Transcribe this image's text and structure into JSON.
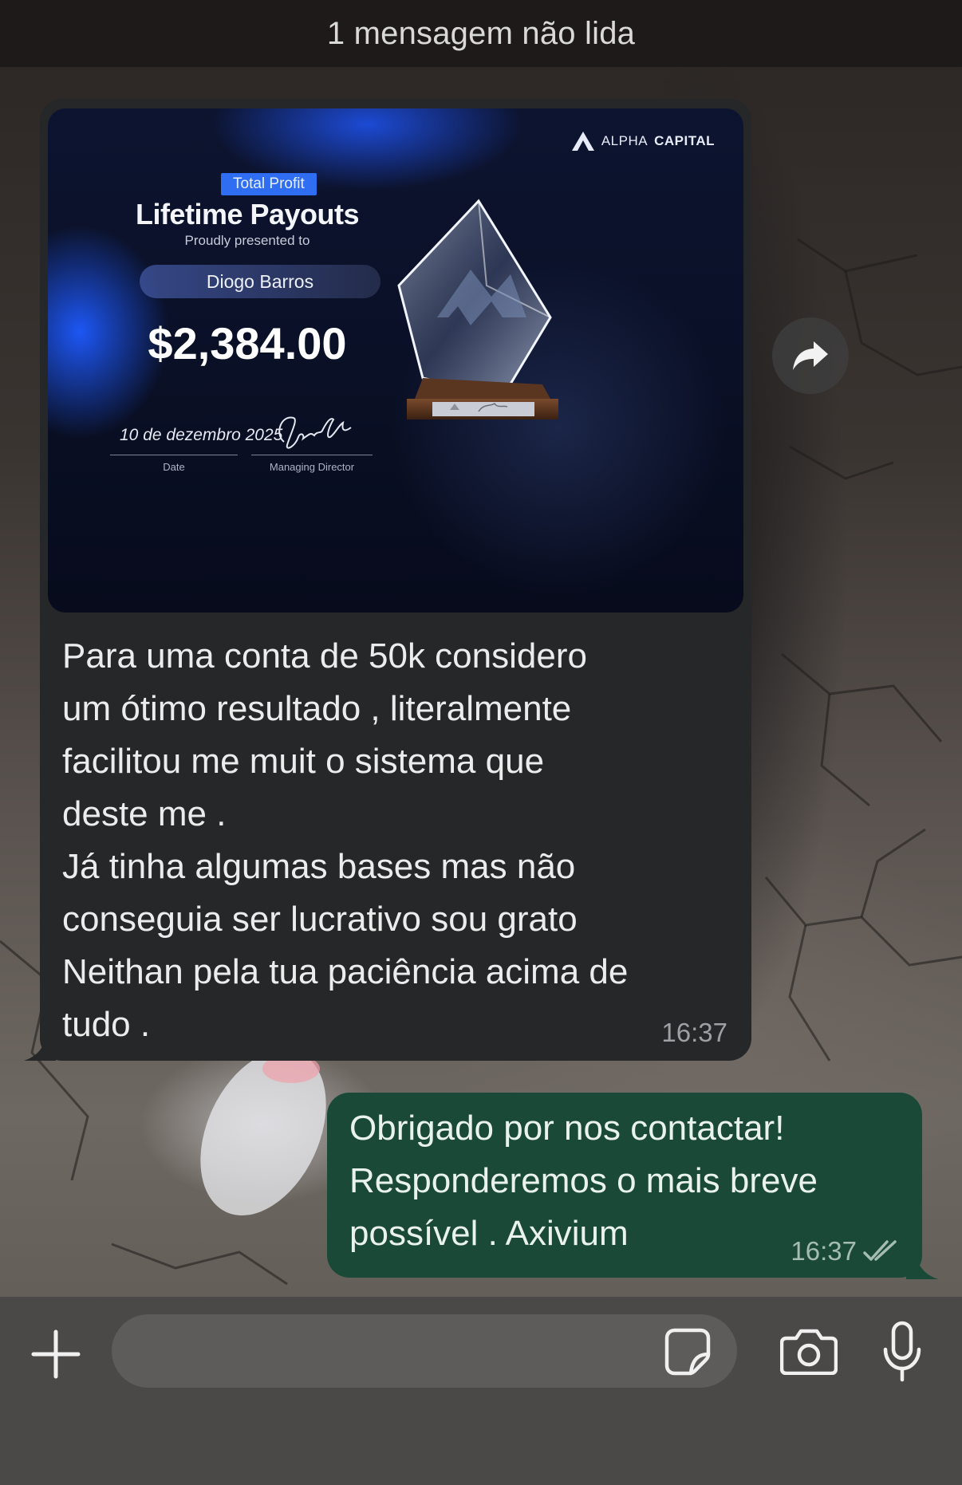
{
  "banner": {
    "unread_text": "1 mensagem não lida"
  },
  "incoming_message": {
    "image": {
      "brand_left": "ALPHA",
      "brand_right": "CAPITAL",
      "badge": "Total Profit",
      "title": "Lifetime Payouts",
      "presented_to": "Proudly presented to",
      "name": "Diogo Barros",
      "amount": "$2,384.00",
      "date": "10 de dezembro 2025",
      "date_label": "Date",
      "director_label": "Managing Director"
    },
    "text": "Para uma conta de 50k considero\num ótimo resultado , literalmente\nfacilitou me muit o sistema que\ndeste me .\nJá tinha algumas bases mas não\nconseguia ser lucrativo sou grato\nNeithan pela tua paciência acima de\ntudo .",
    "time": "16:37"
  },
  "outgoing_message": {
    "text": "Obrigado por nos contactar!\nResponderemos o mais breve\npossível . Axivium",
    "time": "16:37",
    "status": "read"
  },
  "composer": {
    "input_value": "",
    "icons": [
      "plus-icon",
      "sticker-icon",
      "camera-icon",
      "microphone-icon"
    ]
  },
  "colors": {
    "incoming_bubble": "#252728",
    "outgoing_bubble": "#1a4a37",
    "composer_bar": "#4b4948",
    "badge": "#2f6df2"
  }
}
